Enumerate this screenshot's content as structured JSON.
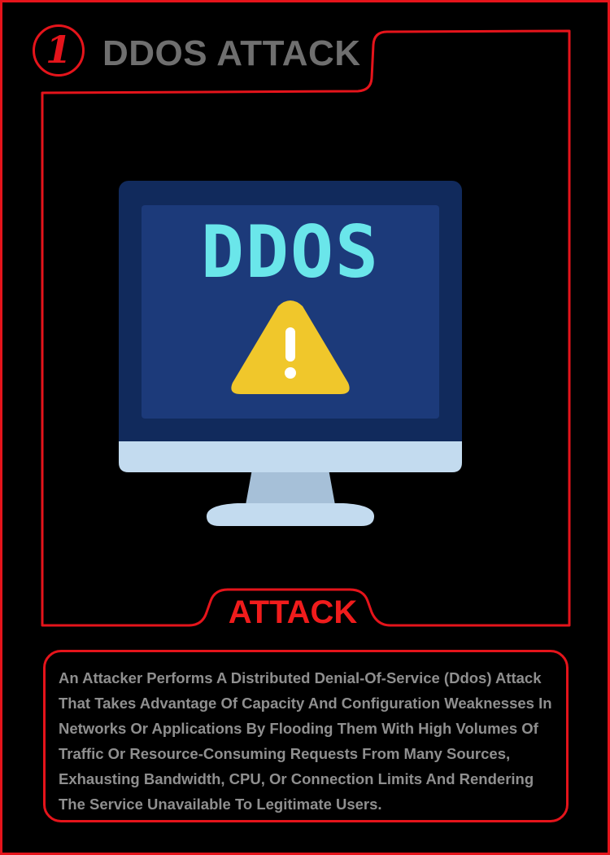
{
  "header": {
    "number": "1",
    "title": "DDOS ATTACK"
  },
  "monitor": {
    "screen_text": "DDOS",
    "warning_icon": "warning-triangle-icon"
  },
  "tab_label": "ATTACK",
  "description": "An Attacker Performs A Distributed Denial-Of-Service (Ddos) Attack That Takes Advantage Of Capacity And Configuration Weaknesses In Networks Or Applications By Flooding Them With High Volumes Of Traffic Or Resource-Consuming Requests From Many Sources, Exhausting Bandwidth, CPU, Or Connection Limits And Rendering The Service Unavailable To Legitimate Users.",
  "colors": {
    "accent": "#e5141b",
    "background": "#000000",
    "title_gray": "#6f6f6f",
    "text_gray": "#8f8f8f",
    "monitor_bezel": "#112a5c",
    "monitor_screen": "#1c3a7a",
    "ddos_cyan": "#6ae6ea",
    "warning_yellow": "#f0c72b",
    "stand_light": "#c3dbef"
  }
}
